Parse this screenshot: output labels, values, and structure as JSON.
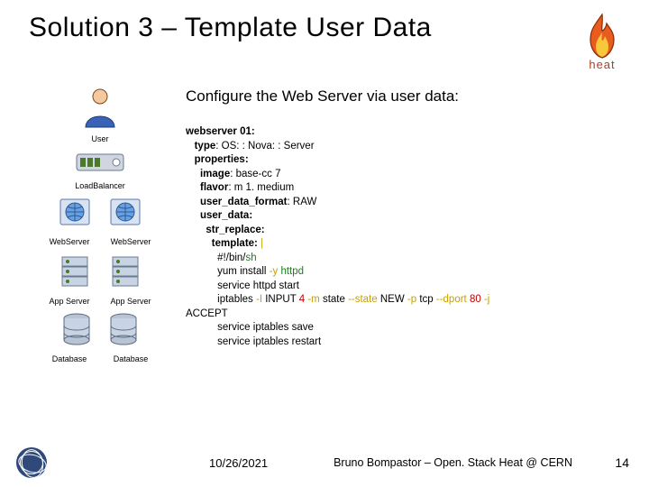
{
  "title": "Solution 3 – Template User Data",
  "logo_label": "heat",
  "subtitle": "Configure the Web Server via user data:",
  "diagram": {
    "user": "User",
    "lb": "LoadBalancer",
    "ws": "WebServer",
    "app": "App Server",
    "db": "Database"
  },
  "code": {
    "l01": "webserver 01:",
    "l02_k": "type",
    "l02_v": ": OS: : Nova: : Server",
    "l03": "properties:",
    "l04_k": "image",
    "l04_v": ": base-cc 7",
    "l05_k": "flavor",
    "l05_v": ": m 1. medium",
    "l06_k": "user_data_format",
    "l06_v": ": RAW",
    "l07": "user_data:",
    "l08": "str_replace:",
    "l09": "template: ",
    "l09_pipe": "|",
    "l10_a": "#!/bin/",
    "l10_b": "sh",
    "l11_a": "yum install ",
    "l11_y": "-y ",
    "l11_b": "httpd",
    "l12": "service httpd start",
    "l13_a": "iptables ",
    "l13_y1": "-I ",
    "l13_b": "INPUT ",
    "l13_n1": "4 ",
    "l13_y2": "-m ",
    "l13_c": "state ",
    "l13_y3": "--state ",
    "l13_d": "NEW ",
    "l13_y4": "-p ",
    "l13_e": "tcp ",
    "l13_y5": "--dport ",
    "l13_n2": "80 ",
    "l13_y6": "-j",
    "l13_cont": "ACCEPT",
    "l14": "service iptables save",
    "l15": "service iptables restart"
  },
  "footer": {
    "date": "10/26/2021",
    "credits": "Bruno Bompastor – Open. Stack Heat @\nCERN",
    "page": "14"
  }
}
